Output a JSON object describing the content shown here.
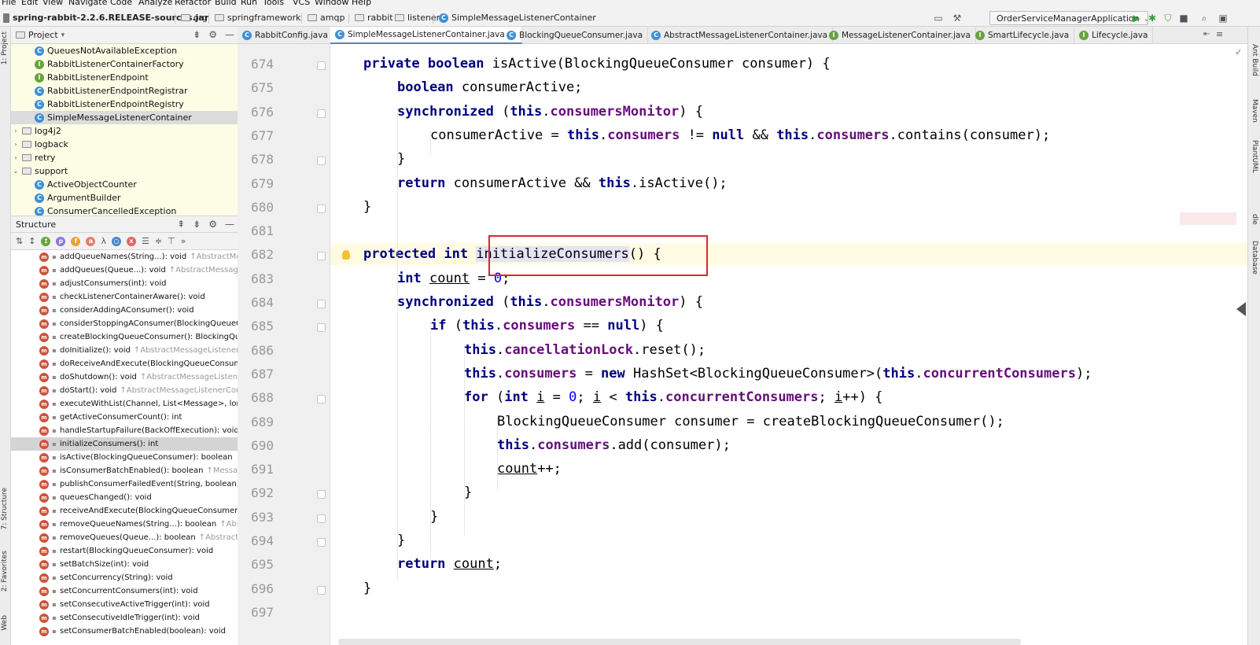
{
  "menu": [
    "File",
    "Edit",
    "View",
    "Navigate",
    "Code",
    "Analyze",
    "Refactor",
    "Build",
    "Run",
    "Tools",
    "VCS",
    "Window",
    "Help"
  ],
  "breadcrumb": [
    "spring-rabbit-2.2.6.RELEASE-sources.jar",
    "org",
    "springframework",
    "amqp",
    "rabbit",
    "listener",
    "SimpleMessageListenerContainer"
  ],
  "run_config": "OrderServiceManagerApplication",
  "left_tool_tabs": [
    "1: Project",
    "7: Structure",
    "2: Favorites",
    "Web"
  ],
  "right_tool_tabs": [
    "Ant Build",
    "Maven",
    "PlantUML",
    "dle",
    "Database"
  ],
  "project_panel": {
    "title": "Project",
    "items": [
      {
        "label": "QueuesNotAvailableException",
        "kind": "class",
        "indent": 2,
        "selected": false
      },
      {
        "label": "RabbitListenerContainerFactory",
        "kind": "interface",
        "indent": 2,
        "selected": false
      },
      {
        "label": "RabbitListenerEndpoint",
        "kind": "interface",
        "indent": 2,
        "selected": false
      },
      {
        "label": "RabbitListenerEndpointRegistrar",
        "kind": "class",
        "indent": 2,
        "selected": false
      },
      {
        "label": "RabbitListenerEndpointRegistry",
        "kind": "class",
        "indent": 2,
        "selected": false
      },
      {
        "label": "SimpleMessageListenerContainer",
        "kind": "class",
        "indent": 2,
        "selected": true
      },
      {
        "label": "log4j2",
        "kind": "folder",
        "indent": 1,
        "expanded": false
      },
      {
        "label": "logback",
        "kind": "folder",
        "indent": 1,
        "expanded": false
      },
      {
        "label": "retry",
        "kind": "folder",
        "indent": 1,
        "expanded": false
      },
      {
        "label": "support",
        "kind": "folder",
        "indent": 1,
        "expanded": true
      },
      {
        "label": "ActiveObjectCounter",
        "kind": "class",
        "indent": 2,
        "selected": false
      },
      {
        "label": "ArgumentBuilder",
        "kind": "class",
        "indent": 2,
        "selected": false
      },
      {
        "label": "ConsumerCancelledException",
        "kind": "class",
        "indent": 2,
        "selected": false
      }
    ]
  },
  "structure_panel": {
    "title": "Structure",
    "items": [
      {
        "text": "addQueueNames(String...): void",
        "inherited": "↑AbstractMes",
        "selected": false
      },
      {
        "text": "addQueues(Queue...): void",
        "inherited": "↑AbstractMessageL",
        "selected": false
      },
      {
        "text": "adjustConsumers(int): void",
        "inherited": "",
        "selected": false
      },
      {
        "text": "checkListenerContainerAware(): void",
        "inherited": "",
        "selected": false
      },
      {
        "text": "considerAddingAConsumer(): void",
        "inherited": "",
        "selected": false
      },
      {
        "text": "considerStoppingAConsumer(BlockingQueueC",
        "inherited": "",
        "selected": false
      },
      {
        "text": "createBlockingQueueConsumer(): BlockingQue",
        "inherited": "",
        "selected": false
      },
      {
        "text": "doInitialize(): void",
        "inherited": "↑AbstractMessageListenerC",
        "selected": false
      },
      {
        "text": "doReceiveAndExecute(BlockingQueueConsume",
        "inherited": "",
        "selected": false
      },
      {
        "text": "doShutdown(): void",
        "inherited": "↑AbstractMessageListener",
        "selected": false
      },
      {
        "text": "doStart(): void",
        "inherited": "↑AbstractMessageListenerCont",
        "selected": false
      },
      {
        "text": "executeWithList(Channel, List<Message>, long",
        "inherited": "",
        "selected": false
      },
      {
        "text": "getActiveConsumerCount(): int",
        "inherited": "",
        "selected": false
      },
      {
        "text": "handleStartupFailure(BackOffExecution): void",
        "inherited": "",
        "selected": false
      },
      {
        "text": "initializeConsumers(): int",
        "inherited": "",
        "selected": true
      },
      {
        "text": "isActive(BlockingQueueConsumer): boolean",
        "inherited": "",
        "selected": false
      },
      {
        "text": "isConsumerBatchEnabled(): boolean",
        "inherited": "↑Messag",
        "selected": false
      },
      {
        "text": "publishConsumerFailedEvent(String, boolean, T",
        "inherited": "",
        "selected": false
      },
      {
        "text": "queuesChanged(): void",
        "inherited": "",
        "selected": false
      },
      {
        "text": "receiveAndExecute(BlockingQueueConsumer):",
        "inherited": "",
        "selected": false
      },
      {
        "text": "removeQueueNames(String...): boolean",
        "inherited": "↑Abstr",
        "selected": false
      },
      {
        "text": "removeQueues(Queue...): boolean",
        "inherited": "↑AbstractM",
        "selected": false
      },
      {
        "text": "restart(BlockingQueueConsumer): void",
        "inherited": "",
        "selected": false
      },
      {
        "text": "setBatchSize(int): void",
        "inherited": "",
        "selected": false
      },
      {
        "text": "setConcurrency(String): void",
        "inherited": "",
        "selected": false
      },
      {
        "text": "setConcurrentConsumers(int): void",
        "inherited": "",
        "selected": false
      },
      {
        "text": "setConsecutiveActiveTrigger(int): void",
        "inherited": "",
        "selected": false
      },
      {
        "text": "setConsecutiveIdleTrigger(int): void",
        "inherited": "",
        "selected": false
      },
      {
        "text": "setConsumerBatchEnabled(boolean): void",
        "inherited": "",
        "selected": false
      }
    ]
  },
  "tabs": [
    {
      "label": "RabbitConfig.java",
      "active": false
    },
    {
      "label": "SimpleMessageListenerContainer.java",
      "active": true
    },
    {
      "label": "BlockingQueueConsumer.java",
      "active": false
    },
    {
      "label": "AbstractMessageListenerContainer.java",
      "active": false
    },
    {
      "label": "MessageListenerContainer.java",
      "active": false
    },
    {
      "label": "SmartLifecycle.java",
      "active": false
    },
    {
      "label": "Lifecycle.java",
      "active": false
    }
  ],
  "editor": {
    "lines": [
      {
        "n": "674",
        "indent": 1,
        "tokens": [
          [
            "kw",
            "private boolean "
          ],
          [
            "",
            "isActive(BlockingQueueConsumer consumer) {"
          ]
        ]
      },
      {
        "n": "675",
        "indent": 2,
        "tokens": [
          [
            "kw",
            "boolean "
          ],
          [
            "",
            "consumerActive;"
          ]
        ]
      },
      {
        "n": "676",
        "indent": 2,
        "tokens": [
          [
            "kw",
            "synchronized "
          ],
          [
            "",
            "("
          ],
          [
            "kw",
            "this"
          ],
          [
            "",
            "."
          ],
          [
            "fld",
            "consumersMonitor"
          ],
          [
            "",
            ") {"
          ]
        ]
      },
      {
        "n": "677",
        "indent": 3,
        "tokens": [
          [
            "",
            "consumerActive = "
          ],
          [
            "kw",
            "this"
          ],
          [
            "",
            "."
          ],
          [
            "fld",
            "consumers "
          ],
          [
            "",
            "!= "
          ],
          [
            "kw",
            "null "
          ],
          [
            "",
            "&& "
          ],
          [
            "kw",
            "this"
          ],
          [
            "",
            "."
          ],
          [
            "fld",
            "consumers"
          ],
          [
            "",
            ".contains(consumer);"
          ]
        ]
      },
      {
        "n": "678",
        "indent": 2,
        "tokens": [
          [
            "",
            "}"
          ]
        ]
      },
      {
        "n": "679",
        "indent": 2,
        "tokens": [
          [
            "kw",
            "return "
          ],
          [
            "",
            "consumerActive && "
          ],
          [
            "kw",
            "this"
          ],
          [
            "",
            ".isActive();"
          ]
        ]
      },
      {
        "n": "680",
        "indent": 1,
        "tokens": [
          [
            "",
            "}"
          ]
        ]
      },
      {
        "n": "681",
        "indent": 0,
        "tokens": []
      },
      {
        "n": "682",
        "indent": 1,
        "tokens": [
          [
            "kw",
            "protected int "
          ],
          [
            "hl",
            "initializeConsumers"
          ],
          [
            "",
            "() {"
          ]
        ]
      },
      {
        "n": "683",
        "indent": 2,
        "tokens": [
          [
            "kw",
            "int "
          ],
          [
            "ul",
            "count"
          ],
          [
            "",
            " = "
          ],
          [
            "num",
            "0"
          ],
          [
            "",
            ";"
          ]
        ]
      },
      {
        "n": "684",
        "indent": 2,
        "tokens": [
          [
            "kw",
            "synchronized "
          ],
          [
            "",
            "("
          ],
          [
            "kw",
            "this"
          ],
          [
            "",
            "."
          ],
          [
            "fld",
            "consumersMonitor"
          ],
          [
            "",
            ") {"
          ]
        ]
      },
      {
        "n": "685",
        "indent": 3,
        "tokens": [
          [
            "kw",
            "if "
          ],
          [
            "",
            "("
          ],
          [
            "kw",
            "this"
          ],
          [
            "",
            "."
          ],
          [
            "fld",
            "consumers "
          ],
          [
            "",
            "== "
          ],
          [
            "kw",
            "null"
          ],
          [
            "",
            ") {"
          ]
        ]
      },
      {
        "n": "686",
        "indent": 4,
        "tokens": [
          [
            "kw",
            "this"
          ],
          [
            "",
            "."
          ],
          [
            "fld",
            "cancellationLock"
          ],
          [
            "",
            ".reset();"
          ]
        ]
      },
      {
        "n": "687",
        "indent": 4,
        "tokens": [
          [
            "kw",
            "this"
          ],
          [
            "",
            "."
          ],
          [
            "fld",
            "consumers "
          ],
          [
            "",
            "= "
          ],
          [
            "kw",
            "new "
          ],
          [
            "",
            "HashSet<BlockingQueueConsumer>("
          ],
          [
            "kw",
            "this"
          ],
          [
            "",
            "."
          ],
          [
            "fld",
            "concurrentConsumers"
          ],
          [
            "",
            ");"
          ]
        ]
      },
      {
        "n": "688",
        "indent": 4,
        "tokens": [
          [
            "kw",
            "for "
          ],
          [
            "",
            "("
          ],
          [
            "kw",
            "int "
          ],
          [
            "ul",
            "i"
          ],
          [
            "",
            " = "
          ],
          [
            "num",
            "0"
          ],
          [
            "",
            "; "
          ],
          [
            "ul",
            "i"
          ],
          [
            "",
            " < "
          ],
          [
            "kw",
            "this"
          ],
          [
            "",
            "."
          ],
          [
            "fld",
            "concurrentConsumers"
          ],
          [
            "",
            "; "
          ],
          [
            "ul",
            "i"
          ],
          [
            "",
            "++) {"
          ]
        ]
      },
      {
        "n": "689",
        "indent": 5,
        "tokens": [
          [
            "",
            "BlockingQueueConsumer consumer = createBlockingQueueConsumer();"
          ]
        ]
      },
      {
        "n": "690",
        "indent": 5,
        "tokens": [
          [
            "kw",
            "this"
          ],
          [
            "",
            "."
          ],
          [
            "fld",
            "consumers"
          ],
          [
            "",
            ".add(consumer);"
          ]
        ]
      },
      {
        "n": "691",
        "indent": 5,
        "tokens": [
          [
            "ul",
            "count"
          ],
          [
            "",
            "++;"
          ]
        ]
      },
      {
        "n": "692",
        "indent": 4,
        "tokens": [
          [
            "",
            "}"
          ]
        ]
      },
      {
        "n": "693",
        "indent": 3,
        "tokens": [
          [
            "",
            "}"
          ]
        ]
      },
      {
        "n": "694",
        "indent": 2,
        "tokens": [
          [
            "",
            "}"
          ]
        ]
      },
      {
        "n": "695",
        "indent": 2,
        "tokens": [
          [
            "kw",
            "return "
          ],
          [
            "ul",
            "count"
          ],
          [
            "",
            ";"
          ]
        ]
      },
      {
        "n": "696",
        "indent": 1,
        "tokens": [
          [
            "",
            "}"
          ]
        ]
      },
      {
        "n": "697",
        "indent": 0,
        "tokens": []
      }
    ]
  },
  "colors": {
    "keyword": "#000080",
    "field": "#660e7a",
    "number": "#0000ff",
    "highlight_box": "#e0242c",
    "project_bg": "#fdfde6"
  }
}
